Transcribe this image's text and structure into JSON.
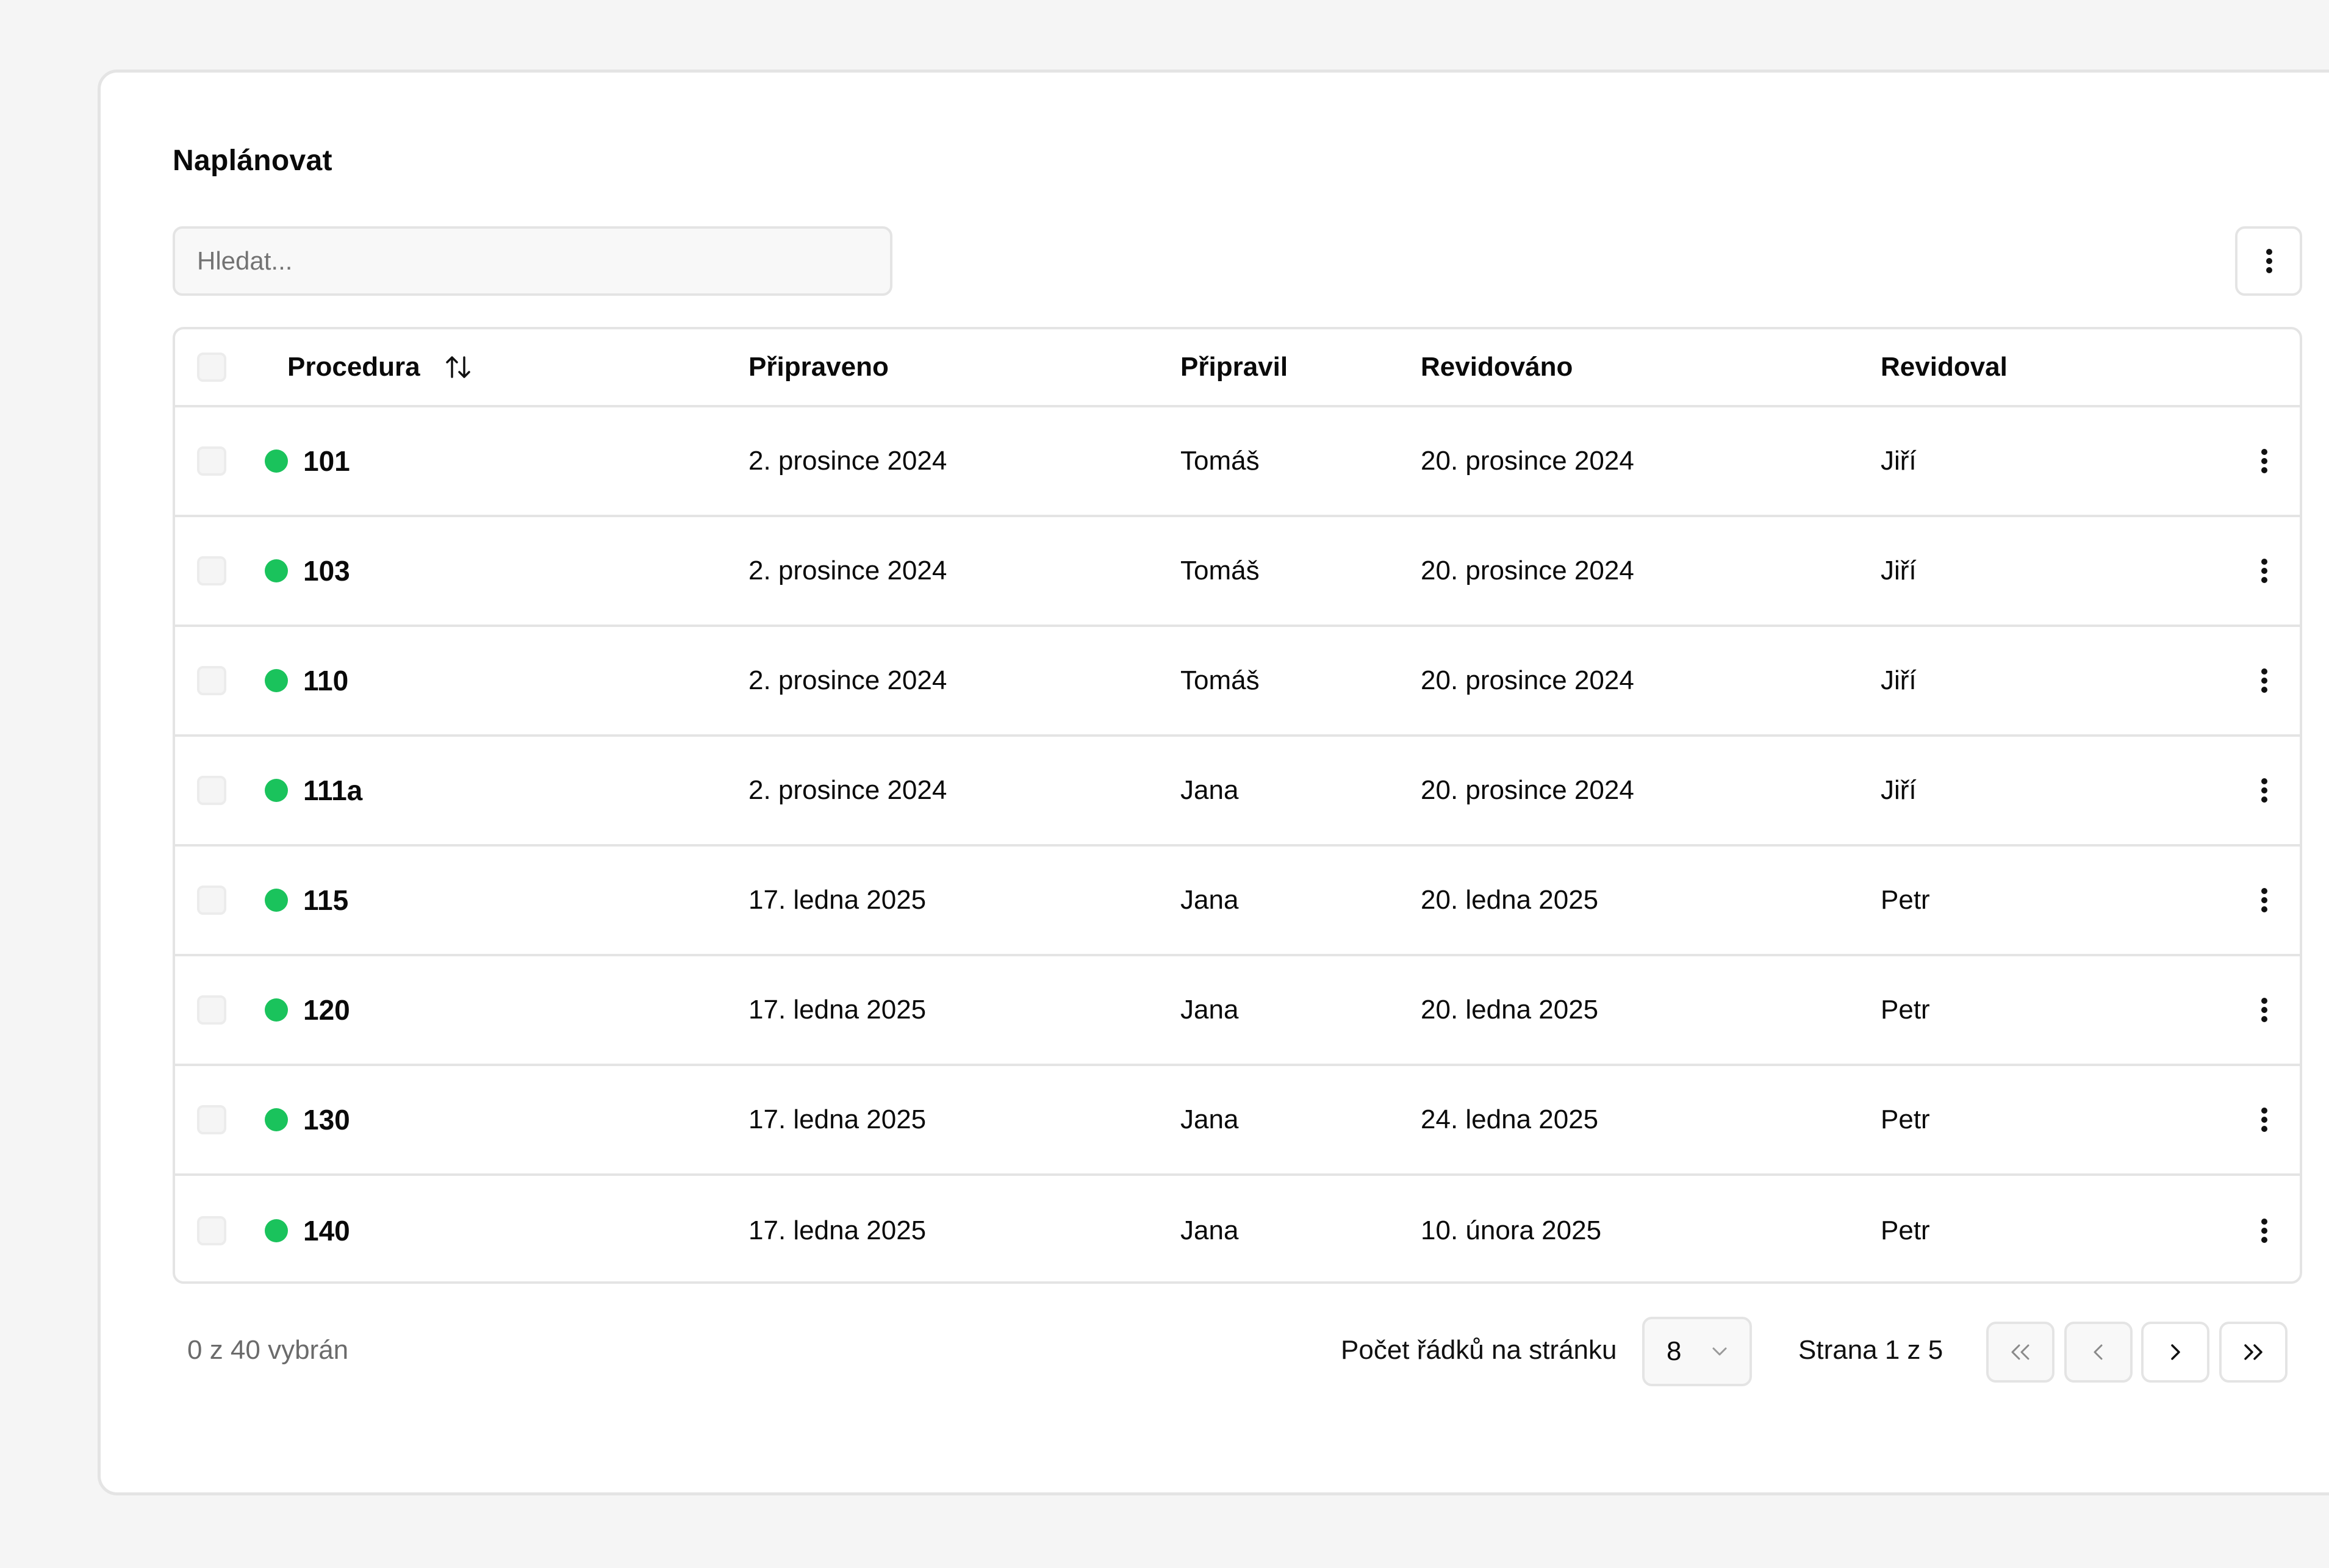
{
  "page": {
    "title": "Naplánovat"
  },
  "search": {
    "placeholder": "Hledat..."
  },
  "toolbar": {
    "menu_icon": "vertical-dots-icon"
  },
  "table": {
    "columns": [
      "Procedura",
      "Připraveno",
      "Připravil",
      "Revidováno",
      "Revidoval"
    ],
    "sort_icon": "sort-arrows-icon",
    "status_color": "#1ac35c",
    "rows": [
      {
        "procedura": "101",
        "pripraveno": "2. prosince 2024",
        "pripravil": "Tomáš",
        "revidovano": "20. prosince 2024",
        "revidoval": "Jiří"
      },
      {
        "procedura": "103",
        "pripraveno": "2. prosince 2024",
        "pripravil": "Tomáš",
        "revidovano": "20. prosince 2024",
        "revidoval": "Jiří"
      },
      {
        "procedura": "110",
        "pripraveno": "2. prosince 2024",
        "pripravil": "Tomáš",
        "revidovano": "20. prosince 2024",
        "revidoval": "Jiří"
      },
      {
        "procedura": "111a",
        "pripraveno": "2. prosince 2024",
        "pripravil": "Jana",
        "revidovano": "20. prosince 2024",
        "revidoval": "Jiří"
      },
      {
        "procedura": "115",
        "pripraveno": "17. ledna 2025",
        "pripravil": "Jana",
        "revidovano": "20. ledna 2025",
        "revidoval": "Petr"
      },
      {
        "procedura": "120",
        "pripraveno": "17. ledna 2025",
        "pripravil": "Jana",
        "revidovano": "20. ledna 2025",
        "revidoval": "Petr"
      },
      {
        "procedura": "130",
        "pripraveno": "17. ledna 2025",
        "pripravil": "Jana",
        "revidovano": "24. ledna 2025",
        "revidoval": "Petr"
      },
      {
        "procedura": "140",
        "pripraveno": "17. ledna 2025",
        "pripravil": "Jana",
        "revidovano": "10. února 2025",
        "revidoval": "Petr"
      }
    ]
  },
  "footer": {
    "selected_text": "0 z 40 vybrán",
    "rows_per_page_label": "Počet řádků na stránku",
    "rows_per_page_value": "8",
    "page_info": "Strana 1 z 5",
    "pagination_icons": [
      "double-chevron-left-icon",
      "chevron-left-icon",
      "chevron-right-icon",
      "double-chevron-right-icon"
    ]
  }
}
